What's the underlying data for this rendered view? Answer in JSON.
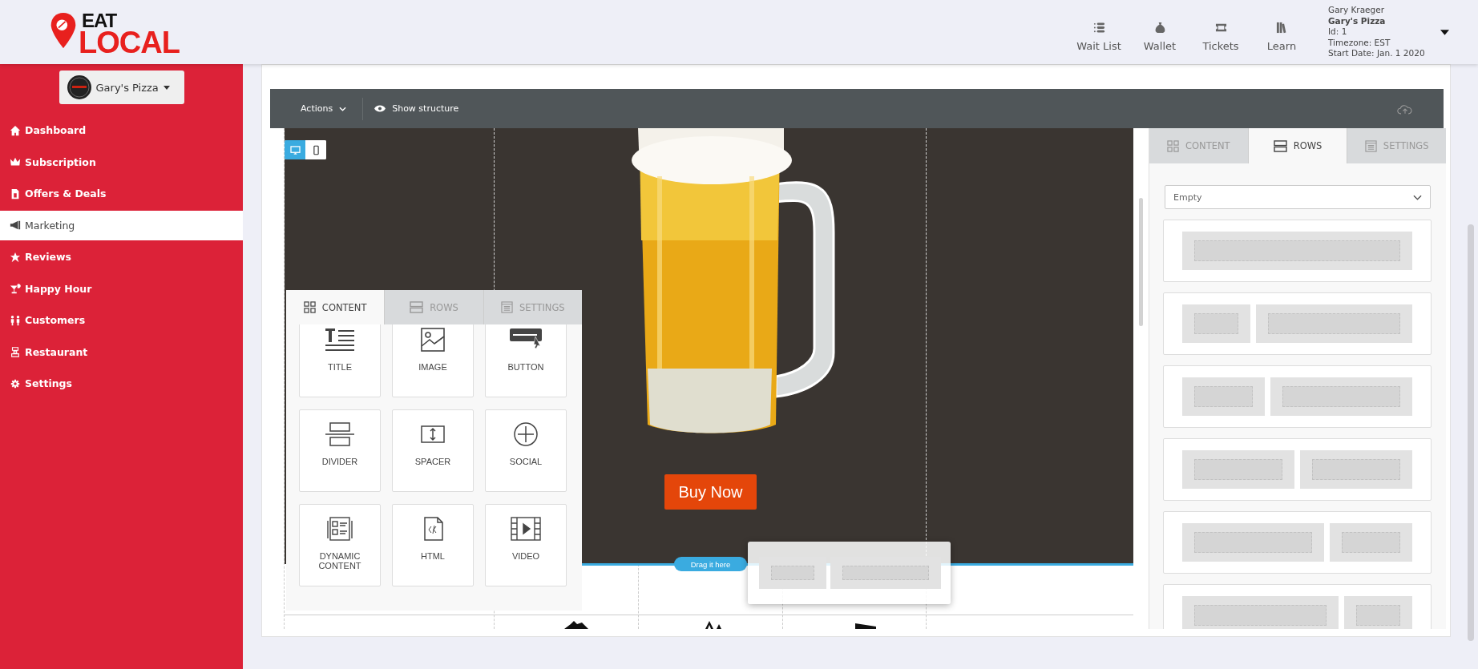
{
  "brand": {
    "logo_top": "EAT",
    "logo_bottom": "LOCAL"
  },
  "header": {
    "nav": [
      {
        "label": "Wait List"
      },
      {
        "label": "Wallet"
      },
      {
        "label": "Tickets"
      },
      {
        "label": "Learn"
      }
    ],
    "account": {
      "name": "Gary Kraeger",
      "business": "Gary's Pizza",
      "id": "Id: 1",
      "timezone": "Timezone: EST",
      "start_date": "Start Date: Jan. 1 2020"
    }
  },
  "sidebar": {
    "restaurant_switcher": "Gary's Pizza",
    "items": [
      {
        "label": "Dashboard",
        "selected": false
      },
      {
        "label": "Subscription",
        "selected": false
      },
      {
        "label": "Offers & Deals",
        "selected": false
      },
      {
        "label": "Marketing",
        "selected": true
      },
      {
        "label": "Reviews",
        "selected": false
      },
      {
        "label": "Happy Hour",
        "selected": false
      },
      {
        "label": "Customers",
        "selected": false
      },
      {
        "label": "Restaurant",
        "selected": false
      },
      {
        "label": "Settings",
        "selected": false
      }
    ]
  },
  "editor": {
    "toolbar": {
      "actions": "Actions",
      "show_structure": "Show structure"
    },
    "view_modes": [
      {
        "kind": "desktop",
        "selected": true
      },
      {
        "kind": "mobile",
        "selected": false
      }
    ],
    "canvas": {
      "button_label": "Buy Now",
      "drop_hint": "Drag it here",
      "dragged_row": {
        "kind": "third"
      }
    },
    "content_panel": {
      "tabs": [
        {
          "label": "CONTENT",
          "selected": true
        },
        {
          "label": "ROWS",
          "selected": false
        },
        {
          "label": "SETTINGS",
          "selected": false
        }
      ],
      "blocks": [
        {
          "label": "TITLE"
        },
        {
          "label": "IMAGE"
        },
        {
          "label": "BUTTON"
        },
        {
          "label": "DIVIDER"
        },
        {
          "label": "SPACER"
        },
        {
          "label": "SOCIAL"
        },
        {
          "label": "DYNAMIC CONTENT"
        },
        {
          "label": "HTML"
        },
        {
          "label": "VIDEO"
        }
      ]
    },
    "rows_panel": {
      "tabs": [
        {
          "label": "CONTENT",
          "selected": false
        },
        {
          "label": "ROWS",
          "selected": true
        },
        {
          "label": "SETTINGS",
          "selected": false
        }
      ],
      "filter": {
        "value": "Empty"
      },
      "layouts": [
        {
          "kind": "full"
        },
        {
          "kind": "quarter"
        },
        {
          "kind": "third"
        },
        {
          "kind": "half"
        },
        {
          "kind": "twothirds"
        },
        {
          "kind": "threequarters"
        }
      ]
    }
  }
}
